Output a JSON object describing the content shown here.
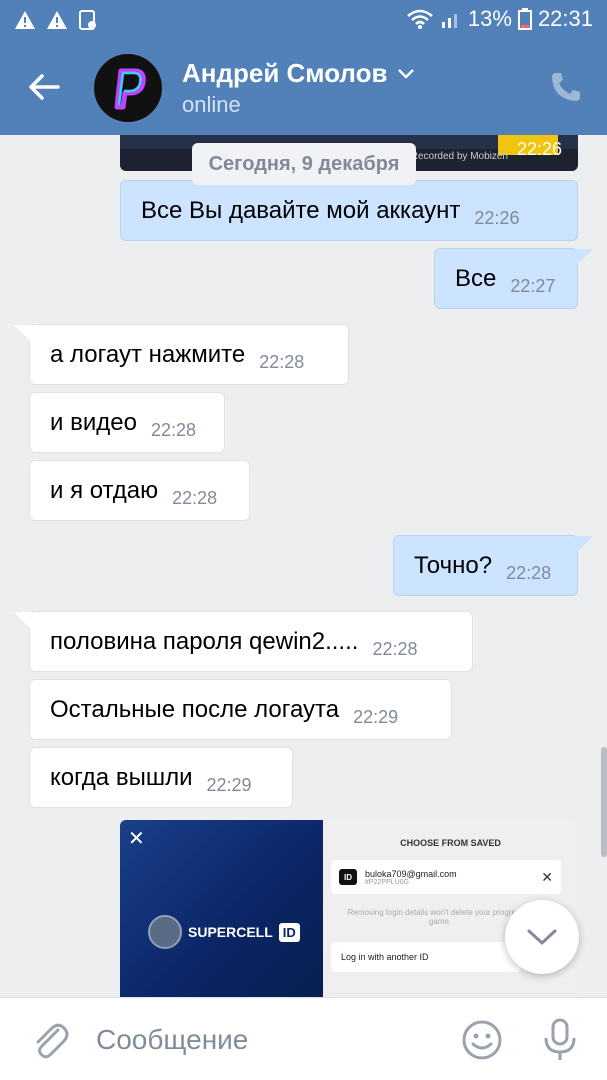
{
  "status_bar": {
    "battery_percent": "13%",
    "time": "22:31"
  },
  "header": {
    "contact_name": "Андрей Смолов",
    "contact_status": "online"
  },
  "colors": {
    "header_bg": "#5181b8",
    "outgoing_bubble": "#cce4ff",
    "incoming_bubble": "#ffffff",
    "timestamp": "#828a99",
    "chat_bg": "#edeef0"
  },
  "chat": {
    "top_attachment_time": "22:26",
    "top_attachment_watermark": "Recorded by Mobizen",
    "date_separator": "Сегодня, 9 декабря",
    "messages": [
      {
        "direction": "out",
        "text": "Все Вы давайте мой аккаунт",
        "time": "22:26"
      },
      {
        "direction": "out",
        "text": "Все",
        "time": "22:27"
      },
      {
        "direction": "in",
        "text": "а логаут нажмите",
        "time": "22:28"
      },
      {
        "direction": "in",
        "text": "и видео",
        "time": "22:28"
      },
      {
        "direction": "in",
        "text": "и я отдаю",
        "time": "22:28"
      },
      {
        "direction": "out",
        "text": "Точно?",
        "time": "22:28"
      },
      {
        "direction": "in",
        "text": "половина пароля qewin2.....",
        "time": "22:28"
      },
      {
        "direction": "in",
        "text": "Остальные после логаута",
        "time": "22:29"
      },
      {
        "direction": "in",
        "text": "когда вышли",
        "time": "22:29"
      }
    ],
    "screenshot": {
      "logo_text": "SUPERCELL",
      "logo_badge": "ID",
      "panel_title": "CHOOSE FROM SAVED",
      "account_email": "buloka709@gmail.com",
      "account_tag": "#P22PPLU0G",
      "id_chip": "ID",
      "note": "Removing login details won't delete your progress in game.",
      "login_other": "Log in with another ID"
    }
  },
  "composer": {
    "placeholder": "Сообщение"
  },
  "icons": {
    "back": "back-arrow-icon",
    "call": "phone-icon",
    "attach": "paperclip-icon",
    "emoji": "emoji-icon",
    "mic": "microphone-icon",
    "scroll_down": "chevron-down-icon"
  }
}
